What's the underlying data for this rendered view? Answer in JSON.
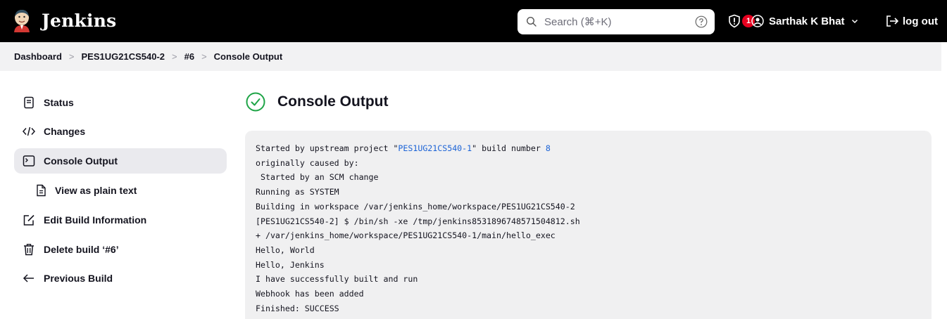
{
  "header": {
    "brand": "Jenkins",
    "search_placeholder": "Search (⌘+K)",
    "security_badge_count": "1",
    "user_name": "Sarthak K Bhat",
    "logout_label": "log out"
  },
  "breadcrumb": {
    "items": [
      "Dashboard",
      "PES1UG21CS540-2",
      "#6",
      "Console Output"
    ],
    "separator": ">"
  },
  "sidebar": {
    "items": [
      {
        "label": "Status",
        "icon": "document-icon"
      },
      {
        "label": "Changes",
        "icon": "code-icon"
      },
      {
        "label": "Console Output",
        "icon": "terminal-icon"
      },
      {
        "label": "View as plain text",
        "icon": "file-text-icon"
      },
      {
        "label": "Edit Build Information",
        "icon": "edit-icon"
      },
      {
        "label": "Delete build ‘#6’",
        "icon": "trash-icon"
      },
      {
        "label": "Previous Build",
        "icon": "arrow-left-icon"
      }
    ]
  },
  "main": {
    "title": "Console Output",
    "status_icon": "success-check-icon",
    "status_color": "#1ea446",
    "console": {
      "line1_prefix": "Started by upstream project \"",
      "upstream_project": "PES1UG21CS540-1",
      "line1_middle": "\" build number ",
      "build_number": "8",
      "lines": [
        "originally caused by:",
        " Started by an SCM change",
        "Running as SYSTEM",
        "Building in workspace /var/jenkins_home/workspace/PES1UG21CS540-2",
        "[PES1UG21CS540-2] $ /bin/sh -xe /tmp/jenkins8531896748571504812.sh",
        "+ /var/jenkins_home/workspace/PES1UG21CS540-1/main/hello_exec",
        "Hello, World",
        "Hello, Jenkins",
        "I have successfully built and run",
        "Webhook has been added",
        "Finished: SUCCESS"
      ]
    }
  },
  "colors": {
    "header_bg": "#000000",
    "badge_red": "#e6001f",
    "link_blue": "#1a62d6",
    "console_bg": "#f0f0f1"
  }
}
